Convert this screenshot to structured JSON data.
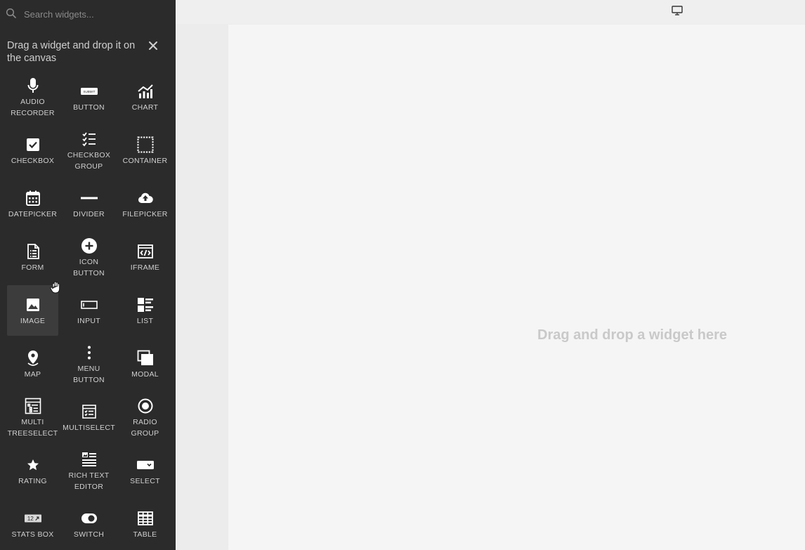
{
  "search": {
    "placeholder": "Search widgets..."
  },
  "hint": "Drag a widget and drop it on the canvas",
  "widgets": [
    {
      "label": "AUDIO\nRECORDER",
      "icon": "microphone-icon"
    },
    {
      "label": "BUTTON",
      "icon": "button-icon"
    },
    {
      "label": "CHART",
      "icon": "chart-icon"
    },
    {
      "label": "CHECKBOX",
      "icon": "checkbox-icon"
    },
    {
      "label": "CHECKBOX\nGROUP",
      "icon": "checklist-icon"
    },
    {
      "label": "CONTAINER",
      "icon": "container-icon"
    },
    {
      "label": "DATEPICKER",
      "icon": "calendar-icon"
    },
    {
      "label": "DIVIDER",
      "icon": "divider-icon"
    },
    {
      "label": "FILEPICKER",
      "icon": "cloud-upload-icon"
    },
    {
      "label": "FORM",
      "icon": "form-icon"
    },
    {
      "label": "ICON\nBUTTON",
      "icon": "plus-circle-icon"
    },
    {
      "label": "IFRAME",
      "icon": "iframe-icon"
    },
    {
      "label": "IMAGE",
      "icon": "image-icon"
    },
    {
      "label": "INPUT",
      "icon": "input-icon"
    },
    {
      "label": "LIST",
      "icon": "list-icon"
    },
    {
      "label": "MAP",
      "icon": "map-pin-icon"
    },
    {
      "label": "MENU\nBUTTON",
      "icon": "kebab-menu-icon"
    },
    {
      "label": "MODAL",
      "icon": "modal-icon"
    },
    {
      "label": "MULTI\nTREESELECT",
      "icon": "tree-select-icon"
    },
    {
      "label": "MULTISELECT",
      "icon": "multiselect-icon"
    },
    {
      "label": "RADIO\nGROUP",
      "icon": "radio-icon"
    },
    {
      "label": "RATING",
      "icon": "star-icon"
    },
    {
      "label": "RICH TEXT\nEDITOR",
      "icon": "rich-text-icon"
    },
    {
      "label": "SELECT",
      "icon": "select-icon"
    },
    {
      "label": "STATS BOX",
      "icon": "stats-box-icon"
    },
    {
      "label": "SWITCH",
      "icon": "switch-icon"
    },
    {
      "label": "TABLE",
      "icon": "table-icon"
    }
  ],
  "selected_widget": "IMAGE",
  "button_icon_text": "SUBMIT",
  "stats_icon_text": "12",
  "canvas": {
    "placeholder": "Drag and drop a widget here"
  },
  "colors": {
    "sidebar": "#2b2b2b",
    "tile_selected": "#3c3c3c",
    "canvas": "#f5f5f5"
  }
}
